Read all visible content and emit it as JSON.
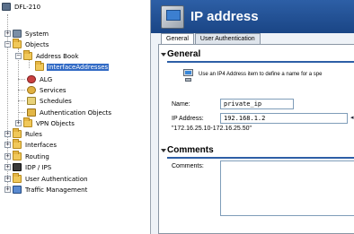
{
  "tree": {
    "root": "DFL-210",
    "items": [
      {
        "label": "System",
        "toggle": "+",
        "icon": "system-icon"
      },
      {
        "label": "Objects",
        "toggle": "−",
        "icon": "objects-folder-icon"
      },
      {
        "label": "Address Book",
        "toggle": "−",
        "icon": "address-book-folder-icon"
      },
      {
        "label": "InterfaceAddresses",
        "toggle": "",
        "icon": "folder-icon",
        "selected": true
      },
      {
        "label": "ALG",
        "toggle": "",
        "icon": "alg-icon"
      },
      {
        "label": "Services",
        "toggle": "",
        "icon": "services-icon"
      },
      {
        "label": "Schedules",
        "toggle": "",
        "icon": "schedules-icon"
      },
      {
        "label": "Authentication Objects",
        "toggle": "",
        "icon": "auth-objects-icon"
      },
      {
        "label": "VPN Objects",
        "toggle": "+",
        "icon": "vpn-objects-icon"
      },
      {
        "label": "Rules",
        "toggle": "+",
        "icon": "rules-icon"
      },
      {
        "label": "Interfaces",
        "toggle": "+",
        "icon": "interfaces-icon"
      },
      {
        "label": "Routing",
        "toggle": "+",
        "icon": "routing-icon"
      },
      {
        "label": "IDP / IPS",
        "toggle": "+",
        "icon": "idp-ips-icon"
      },
      {
        "label": "User Authentication",
        "toggle": "+",
        "icon": "user-auth-icon"
      },
      {
        "label": "Traffic Management",
        "toggle": "+",
        "icon": "traffic-management-icon"
      }
    ]
  },
  "header": {
    "title": "IP address"
  },
  "tabs": [
    {
      "label": "General",
      "active": true
    },
    {
      "label": "User Authentication",
      "active": false
    }
  ],
  "general": {
    "title": "General",
    "info": "Use an IP4 Address item to define a name for a spe",
    "name_label": "Name:",
    "name_value": "private_ip",
    "ip_label": "IP Address:",
    "ip_value": "192.168.1.2",
    "hint": "\"172.16.25.10-172.16.25.50\""
  },
  "comments": {
    "title": "Comments",
    "label": "Comments:",
    "value": ""
  },
  "colors": {
    "header": "#2d5fa6",
    "selection": "#316ac5",
    "panel": "#eef2f7"
  }
}
